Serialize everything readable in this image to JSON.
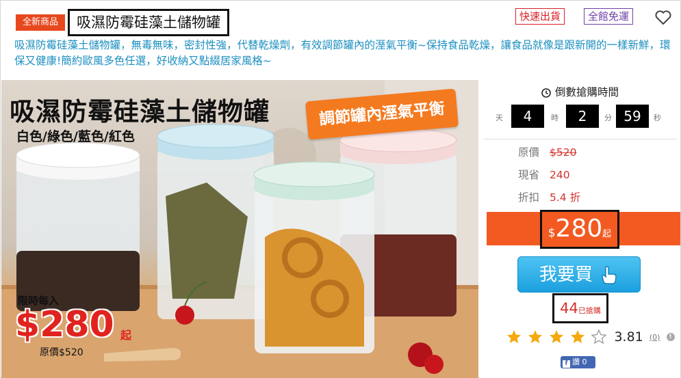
{
  "header": {
    "badge": "全新商品",
    "title": "吸濕防霉硅藻土儲物罐",
    "tags": [
      "快速出貨",
      "全館免運"
    ],
    "description": "吸濕防霉硅藻土儲物罐，無毒無味，密封性強，代替乾燥劑，有效調節罐內的溼氣平衡~保持食品乾燥，讓食品就像是跟新開的一樣新鮮，環保又健康!簡約歐風多色任選，好收納又點綴居家風格~"
  },
  "banner": {
    "title": "吸濕防霉硅藻土儲物罐",
    "colors": "白色/綠色/藍色/紅色",
    "slogan": "調節罐內溼氣平衡",
    "promo_label": "限時每入",
    "promo_price": "$280",
    "promo_suffix": "起",
    "promo_original": "原價$520"
  },
  "countdown": {
    "title": "倒數搶購時間",
    "days": "4",
    "days_unit": "天",
    "hours": "2",
    "hours_unit": "時",
    "minutes": "59",
    "minutes_unit": "分",
    "seconds_unit": "秒"
  },
  "pricing": {
    "original_label": "原價",
    "original_value": "$520",
    "save_label": "現省",
    "save_value": "240",
    "discount_label": "折扣",
    "discount_value": "5.4 折",
    "sale_currency": "$",
    "sale_price": "280",
    "sale_suffix": "起"
  },
  "buy_button": "我要買",
  "sold": {
    "count": "44",
    "label": "已搶購"
  },
  "rating": {
    "value": "3.81",
    "count": "(0)",
    "stars_filled": 4,
    "stars_total": 5
  },
  "facebook": {
    "label": "讚",
    "count": "0"
  },
  "colors": {
    "accent": "#f25a21",
    "price_red": "#d4322c",
    "link_blue": "#1c8fc0",
    "buy_blue": "#1ba0de"
  }
}
